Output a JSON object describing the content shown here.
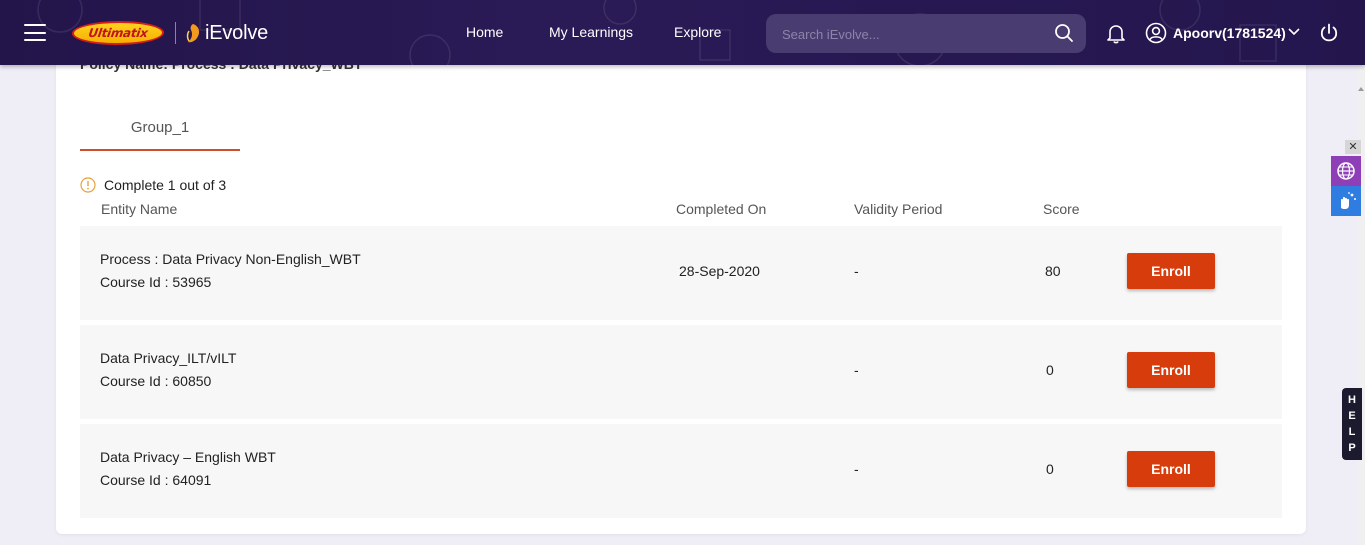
{
  "header": {
    "brand_primary": "Ultimatix",
    "brand_secondary": "iEvolve",
    "nav": [
      {
        "label": "Home"
      },
      {
        "label": "My Learnings"
      },
      {
        "label": "Explore"
      }
    ],
    "search_placeholder": "Search iEvolve...",
    "user_name": "Apoorv(1781524)"
  },
  "page": {
    "policy_name": "Policy Name:  Process : Data Privacy_WBT",
    "tab_label": "Group_1",
    "completion_text": "Complete 1 out of 3",
    "columns": {
      "entity_name": "Entity Name",
      "completed_on": "Completed On",
      "validity_period": "Validity Period",
      "score": "Score"
    },
    "rows": [
      {
        "name": "Process : Data Privacy Non-English_WBT",
        "course_id": "Course Id : 53965",
        "completed_on": "28-Sep-2020",
        "validity": "-",
        "score": "80",
        "action": "Enroll"
      },
      {
        "name": "Data Privacy_ILT/vILT",
        "course_id": "Course Id : 60850",
        "completed_on": "",
        "validity": "-",
        "score": "0",
        "action": "Enroll"
      },
      {
        "name": "Data Privacy – English WBT",
        "course_id": "Course Id : 64091",
        "completed_on": "",
        "validity": "-",
        "score": "0",
        "action": "Enroll"
      }
    ]
  },
  "side": {
    "close_glyph": "✕",
    "help_letters": [
      "H",
      "E",
      "L",
      "P"
    ]
  },
  "icons": {
    "menu": "hamburger-icon",
    "search": "search-icon",
    "bell": "bell-icon",
    "user": "user-icon",
    "chevron": "chevron-down-icon",
    "power": "power-icon",
    "warning": "warning-icon"
  },
  "colors": {
    "header_bg": "#24164d",
    "accent": "#d73d0c",
    "tab_underline": "#c8502e",
    "warning": "#e8a23a"
  }
}
